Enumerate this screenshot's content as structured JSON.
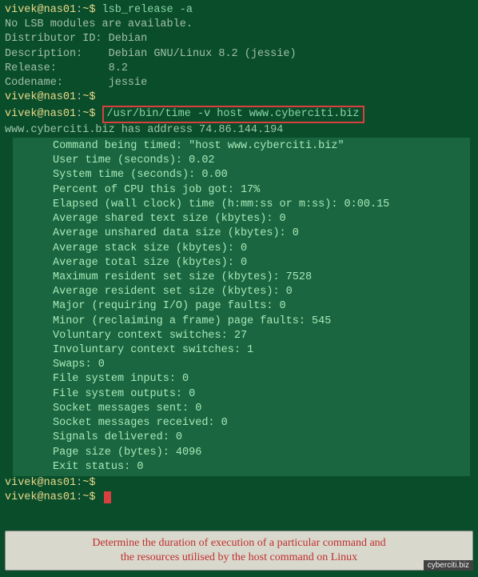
{
  "prompt": {
    "user": "vivek@nas01",
    "sep": ":",
    "path": "~$ "
  },
  "cmd1": "lsb_release -a",
  "lsb": {
    "l1": "No LSB modules are available.",
    "l2": "Distributor ID: Debian",
    "l3": "Description:    Debian GNU/Linux 8.2 (jessie)",
    "l4": "Release:        8.2",
    "l5": "Codename:       jessie"
  },
  "cmd2": "/usr/bin/time -v host www.cyberciti.biz",
  "dns": "www.cyberciti.biz has address 74.86.144.194",
  "time": {
    "t1": "Command being timed: \"host www.cyberciti.biz\"",
    "t2": "User time (seconds): 0.02",
    "t3": "System time (seconds): 0.00",
    "t4": "Percent of CPU this job got: 17%",
    "t5": "Elapsed (wall clock) time (h:mm:ss or m:ss): 0:00.15",
    "t6": "Average shared text size (kbytes): 0",
    "t7": "Average unshared data size (kbytes): 0",
    "t8": "Average stack size (kbytes): 0",
    "t9": "Average total size (kbytes): 0",
    "t10": "Maximum resident set size (kbytes): 7528",
    "t11": "Average resident set size (kbytes): 0",
    "t12": "Major (requiring I/O) page faults: 0",
    "t13": "Minor (reclaiming a frame) page faults: 545",
    "t14": "Voluntary context switches: 27",
    "t15": "Involuntary context switches: 1",
    "t16": "Swaps: 0",
    "t17": "File system inputs: 0",
    "t18": "File system outputs: 0",
    "t19": "Socket messages sent: 0",
    "t20": "Socket messages received: 0",
    "t21": "Signals delivered: 0",
    "t22": "Page size (bytes): 4096",
    "t23": "Exit status: 0"
  },
  "caption": {
    "l1": "Determine the duration of execution of a particular command and",
    "l2": "the resources utilised by the host command on Linux"
  },
  "watermark": "cyberciti.biz"
}
